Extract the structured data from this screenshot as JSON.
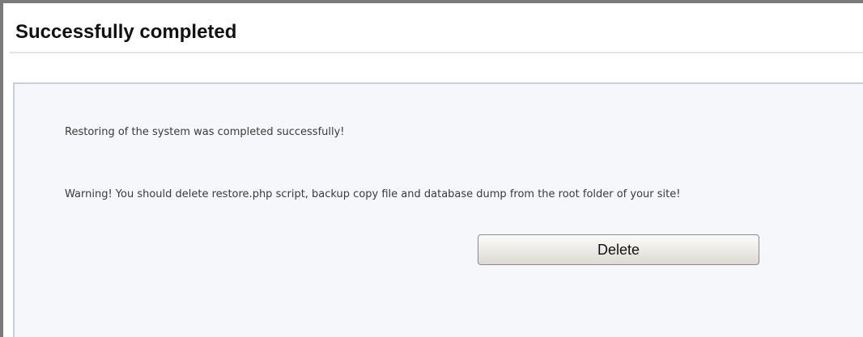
{
  "page": {
    "title": "Successfully completed"
  },
  "panel": {
    "success_message": "Restoring of the system was completed successfully!",
    "warning_message": "Warning! You should delete restore.php script, backup copy file and database dump from the root folder of your site!",
    "delete_label": "Delete"
  },
  "colors": {
    "frame_border": "#7b7b7b",
    "panel_background": "#f6f7fa",
    "panel_border": "#c9cde0",
    "text": "#3a3a3a",
    "title_text": "#111111"
  }
}
